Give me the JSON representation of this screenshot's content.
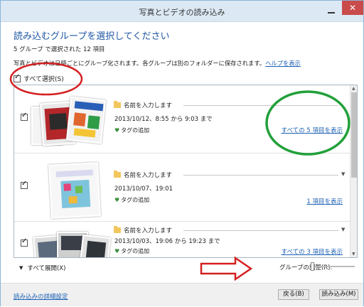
{
  "window": {
    "title": "写真とビデオの読み込み",
    "close_glyph": "✕"
  },
  "heading": "読み込むグループを選択してください",
  "summary": "5 グループ で選択された 12 項目",
  "info": {
    "text": "写真とビデオは日時ごとにグループ化されます。各グループは別のフォルダーに保存されます。",
    "help_link": "ヘルプを表示"
  },
  "select_all": {
    "label": "すべて選択(S)",
    "checked": true
  },
  "groups": [
    {
      "name_placeholder": "名前を入力します",
      "date": "2013/10/12、8:55 から 9:03 まで",
      "tag": "タグの追加",
      "link": "すべての 5 項目を表示",
      "checked": true
    },
    {
      "name_placeholder": "名前を入力します",
      "date": "2013/10/07、19:01",
      "tag": "タグの追加",
      "link": "1 項目を表示",
      "checked": true
    },
    {
      "name_placeholder": "名前を入力します",
      "date": "2013/10/03、19:06 から 19:23 まで",
      "tag": "タグの追加",
      "link": "すべての 3 項目を表示",
      "checked": true
    }
  ],
  "expand_all": "すべて展開(X)",
  "group_adjust": {
    "label": "グループの調整(R):",
    "level": 0
  },
  "footer": {
    "detail_link": "読み込みの詳細設定",
    "back_button": "戻る(B)",
    "import_button": "読み込み(M)"
  },
  "colors": {
    "accent_link": "#1a5fb4",
    "heading": "#1f57a6",
    "annotation_red": "#d42020",
    "annotation_green": "#22a03a",
    "close_button": "#c94b4b"
  }
}
